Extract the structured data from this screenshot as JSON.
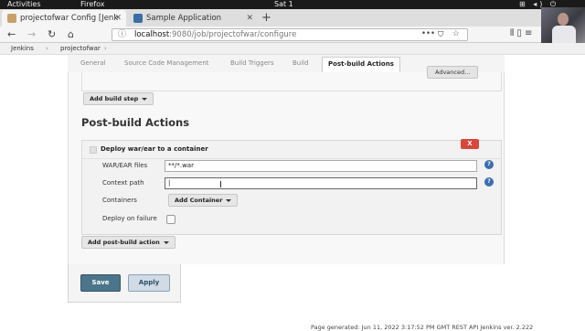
{
  "topbar": {
    "activities": "Activities",
    "app": "Firefox",
    "clock": "Sat 1",
    "tray": "⊞ ◂) ⏻"
  },
  "tabs": [
    {
      "label": "projectofwar Config [Jenk",
      "close": "✕"
    },
    {
      "label": "Sample Application",
      "close": "✕"
    }
  ],
  "new_tab": "+",
  "nav": {
    "back": "←",
    "forward": "→",
    "reload": "↻",
    "home": "⌂",
    "url_host": "localhost",
    "url_path": ":9080/job/projectofwar/configure",
    "url_dots": "•••",
    "url_pocket": "⛉",
    "url_star": "☆",
    "right_icons": "⫴ ▯ ≡"
  },
  "breadcrumb": {
    "items": [
      "Jenkins",
      "projectofwar"
    ],
    "separator": "›"
  },
  "config_tabs": [
    "General",
    "Source Code Management",
    "Build Triggers",
    "Build",
    "Post-build Actions"
  ],
  "advanced_button": "Advanced...",
  "add_build_step": "Add build step",
  "section_title": "Post-build Actions",
  "deploy": {
    "title": "Deploy war/ear to a container",
    "delete": "X",
    "war_label": "WAR/EAR files",
    "war_value": "**/*.war",
    "context_label": "Context path",
    "context_value": "|",
    "containers_label": "Containers",
    "add_container": "Add Container",
    "failure_label": "Deploy on failure",
    "help": "?",
    "cursor": "I"
  },
  "add_post_build": "Add post-build action",
  "save": "Save",
  "apply": "Apply",
  "footer": "Page generated: Jun 11, 2022 3:17:52 PM GMT   REST API   Jenkins ver. 2.222",
  "colors": {
    "save_bg": "#4b758b",
    "delete_bg": "#d9463b",
    "help_bg": "#3c6eb0",
    "jenkins_fav": "#c8a16a",
    "sample_fav": "#3a6ea5"
  }
}
